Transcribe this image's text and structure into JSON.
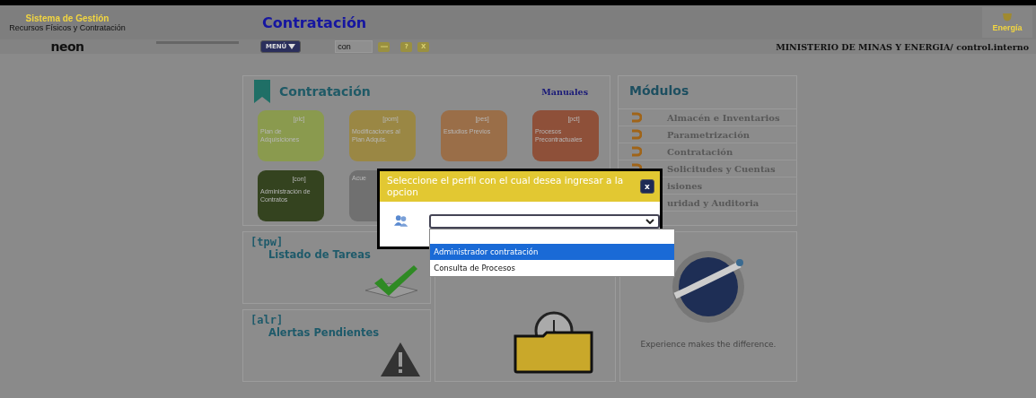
{
  "header": {
    "system_title": "Sistema de Gestión",
    "system_subtitle": "Recursos Físicos y Contratación",
    "logo": "neon",
    "page_title": "Contratación",
    "brand": "Energía",
    "menu_button": "MENÚ",
    "search_value": "con",
    "help_button": "?",
    "close_button": "X",
    "user": "MINISTERIO DE MINAS Y ENERGIA/ control.interno"
  },
  "contratacion": {
    "title": "Contratación",
    "manuals_link": "Manuales",
    "tiles": [
      {
        "code": "[plc]",
        "label": "Plan de Adquisiciones",
        "color": "#8a9a4e"
      },
      {
        "code": "[pom]",
        "label": "Modificaciones al Plan Adquis.",
        "color": "#9a8744"
      },
      {
        "code": "[pes]",
        "label": "Estudios Previos",
        "color": "#9a6e48"
      },
      {
        "code": "[pct]",
        "label": "Procesos Precontractuales",
        "color": "#8e5039"
      },
      {
        "code": "[con]",
        "label": "Administración de Contratos",
        "color": "#34431f"
      },
      {
        "label": "Acue",
        "color": "#707070"
      }
    ]
  },
  "modules": {
    "title": "Módulos",
    "items": [
      "Almacén e Inventarios",
      "Parametrización",
      "Contratación",
      "Solicitudes y Cuentas",
      "isiones",
      "uridad y Auditoria"
    ]
  },
  "tasks": {
    "code": "[tpw]",
    "title": "Listado de Tareas"
  },
  "alerts": {
    "code": "[alr]",
    "title": "Alertas Pendientes"
  },
  "brand_panel": {
    "slogan": "Experience makes the difference."
  },
  "dialog": {
    "title": "Seleccione el perfil con el cual desea ingresar a la opcion",
    "close": "x",
    "options": [
      {
        "label": "Administrador contratación",
        "selected": true
      },
      {
        "label": "Consulta de Procesos",
        "selected": false
      }
    ]
  }
}
